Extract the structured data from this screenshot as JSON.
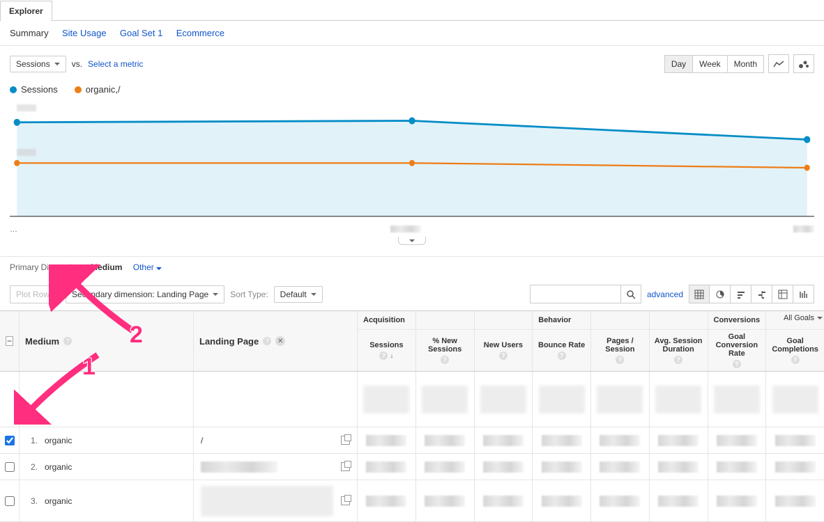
{
  "tabs": {
    "explorer": "Explorer"
  },
  "subnav": {
    "summary": "Summary",
    "site_usage": "Site Usage",
    "goal_set_1": "Goal Set 1",
    "ecommerce": "Ecommerce"
  },
  "metric": {
    "primary": "Sessions",
    "vs": "vs.",
    "select": "Select a metric"
  },
  "time_buttons": {
    "day": "Day",
    "week": "Week",
    "month": "Month"
  },
  "legend": {
    "a": "Sessions",
    "b": "organic,/"
  },
  "xaxis": {
    "left": "…",
    "mid": "",
    "right": ""
  },
  "primary_dimension": {
    "label": "Primary Dimension:",
    "value": "Medium",
    "other": "Other"
  },
  "controls": {
    "plot_rows": "Plot Rows",
    "secondary_dimension": "Secondary dimension: Landing Page",
    "sort_type": "Sort Type:",
    "sort_default": "Default",
    "advanced": "advanced"
  },
  "table": {
    "all_goals": "All Goals",
    "groups": {
      "acquisition": "Acquisition",
      "behavior": "Behavior",
      "conversions": "Conversions"
    },
    "headers": {
      "medium": "Medium",
      "landing_page": "Landing Page",
      "sessions": "Sessions",
      "pct_new_sessions": "% New Sessions",
      "new_users": "New Users",
      "bounce_rate": "Bounce Rate",
      "pages_session": "Pages / Session",
      "avg_session_duration": "Avg. Session Duration",
      "goal_conv_rate": "Goal Conversion Rate",
      "goal_completions": "Goal Completions"
    },
    "rows": [
      {
        "n": "1.",
        "medium": "organic",
        "landing": "/",
        "checked": true
      },
      {
        "n": "2.",
        "medium": "organic",
        "landing": "",
        "checked": false
      },
      {
        "n": "3.",
        "medium": "organic",
        "landing": "",
        "checked": false
      }
    ]
  },
  "annotations": {
    "one": "1",
    "two": "2"
  },
  "chart_data": {
    "type": "line",
    "series": [
      {
        "name": "Sessions",
        "color": "#058dc7",
        "values": [
          122,
          122,
          124,
          107,
          100
        ]
      },
      {
        "name": "organic,/",
        "color": "#ed7e17",
        "values": [
          58,
          58,
          58,
          57,
          54
        ]
      }
    ],
    "x": [
      0,
      1,
      2,
      3,
      4
    ],
    "ylim": [
      0,
      150
    ],
    "xlabel": "",
    "ylabel": "",
    "title": ""
  }
}
